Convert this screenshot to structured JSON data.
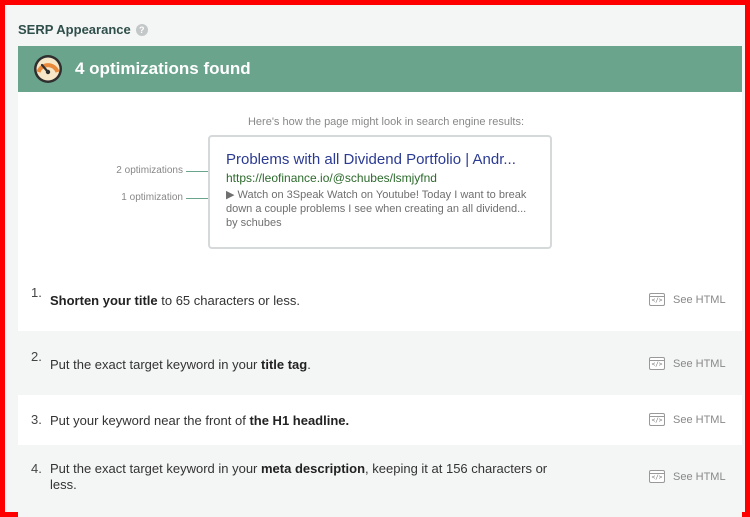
{
  "section": {
    "title": "SERP Appearance",
    "help_icon": "?"
  },
  "banner": {
    "icon": "gauge-icon",
    "text": "4 optimizations found",
    "color": "#6aa48d"
  },
  "preview": {
    "caption": "Here's how the page might look in search engine results:",
    "title": "Problems with all Dividend Portfolio | Andr...",
    "url": "https://leofinance.io/@schubes/lsmjyfnd",
    "description_line1": "▶ Watch on 3Speak Watch on Youtube! Today I want to break",
    "description_line2": "down a couple problems I see when creating an all dividend...",
    "description_line3": "by schubes",
    "title_annotation": "2 optimizations",
    "description_annotation": "1 optimization"
  },
  "optimizations": [
    {
      "number": "1.",
      "bold1": "Shorten your title",
      "rest1": " to 65 characters or less.",
      "pre": "",
      "bold2": "",
      "post": ""
    },
    {
      "number": "2.",
      "pre": "Put the exact target keyword in your ",
      "bold2": "title tag",
      "post": "."
    },
    {
      "number": "3.",
      "pre": "Put your keyword near the front of ",
      "bold2": "the H1 headline.",
      "post": ""
    },
    {
      "number": "4.",
      "pre": "Put the exact target keyword in your ",
      "bold2": "meta description",
      "post": ", keeping it at 156 characters or",
      "line2": "less."
    }
  ],
  "see_html_label": "See HTML",
  "code_icon_glyph": "</>"
}
